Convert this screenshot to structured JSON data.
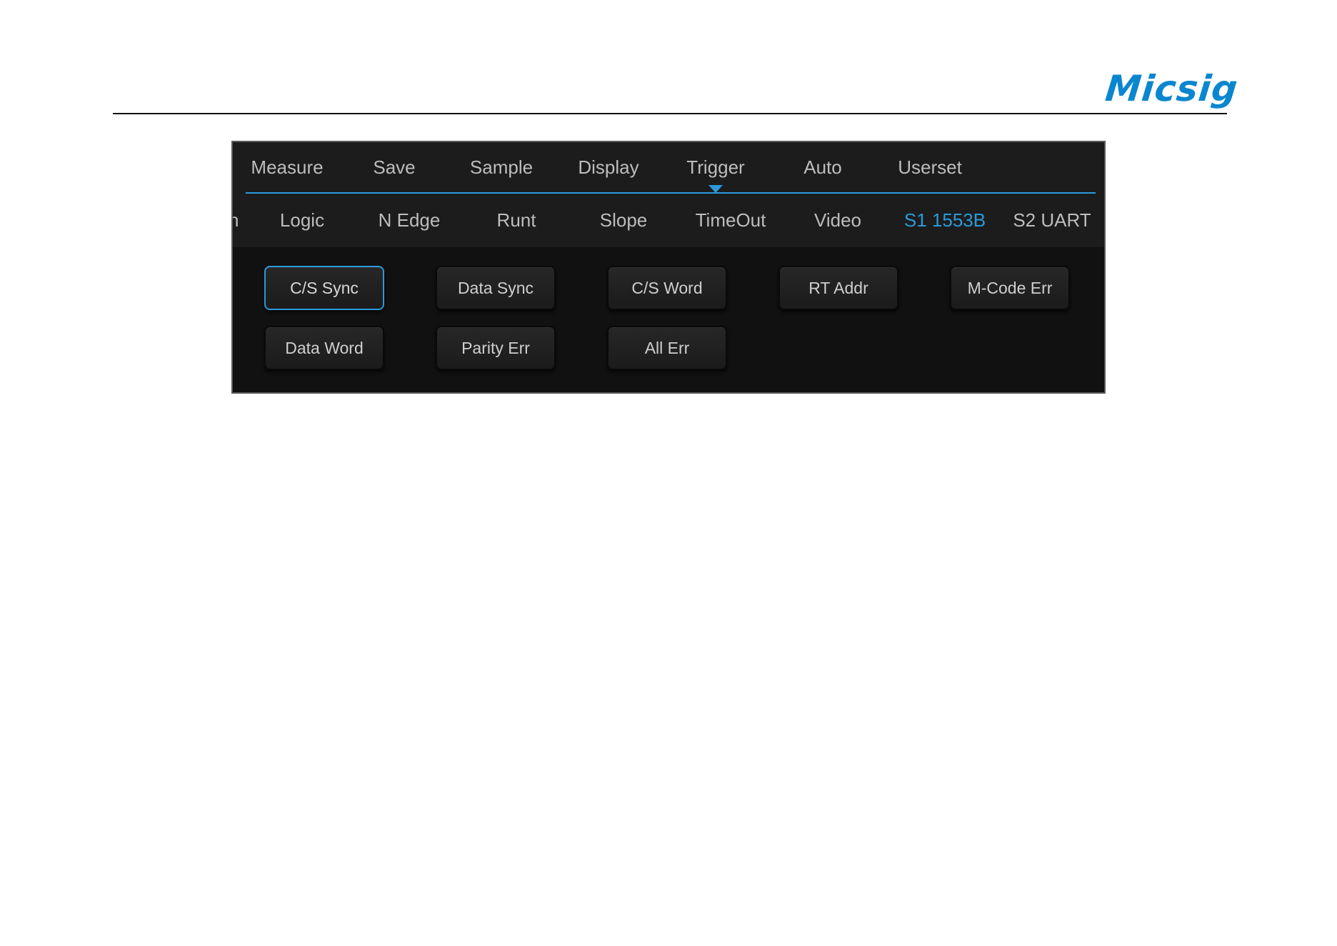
{
  "brand": {
    "logo_text": "Micsig",
    "accent_color": "#2a9ad8",
    "logo_color": "#0a86d0"
  },
  "top_menu": {
    "items": [
      {
        "label": "Measure"
      },
      {
        "label": "Save"
      },
      {
        "label": "Sample"
      },
      {
        "label": "Display"
      },
      {
        "label": "Trigger"
      },
      {
        "label": "Auto"
      },
      {
        "label": "Userset"
      }
    ],
    "active": "Trigger"
  },
  "sub_menu": {
    "items": [
      {
        "label": "h"
      },
      {
        "label": "Logic"
      },
      {
        "label": "N Edge"
      },
      {
        "label": "Runt"
      },
      {
        "label": "Slope"
      },
      {
        "label": "TimeOut"
      },
      {
        "label": "Video"
      },
      {
        "label": "S1 1553B"
      },
      {
        "label": "S2 UART"
      }
    ],
    "active": "S1 1553B"
  },
  "options": {
    "buttons": [
      {
        "label": "C/S Sync"
      },
      {
        "label": "Data Sync"
      },
      {
        "label": "C/S Word"
      },
      {
        "label": "RT Addr"
      },
      {
        "label": "M-Code Err"
      },
      {
        "label": "Data Word"
      },
      {
        "label": "Parity Err"
      },
      {
        "label": "All Err"
      }
    ],
    "selected": "C/S Sync"
  }
}
